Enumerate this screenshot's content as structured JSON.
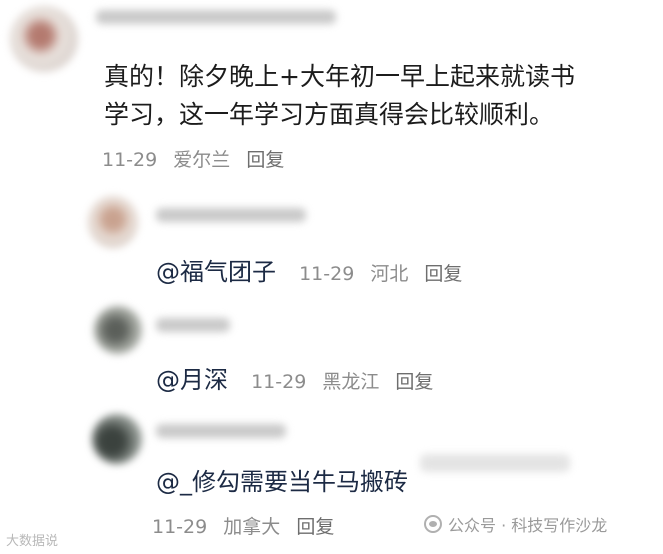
{
  "main_comment": {
    "line1": "真的！除夕晚上+大年初一早上起来就读书",
    "line2": "学习，这一年学习方面真得会比较顺利。",
    "date": "11-29",
    "location": "爱尔兰",
    "reply_label": "回复"
  },
  "replies": [
    {
      "mention": "@福气团子",
      "date": "11-29",
      "location": "河北",
      "reply_label": "回复"
    },
    {
      "mention": "@月深",
      "date": "11-29",
      "location": "黑龙江",
      "reply_label": "回复"
    },
    {
      "mention": "@_修勾需要当牛马搬砖",
      "date": "11-29",
      "location": "加拿大",
      "reply_label": "回复"
    }
  ],
  "watermarks": {
    "left": "大数据说",
    "right": "公众号 · 科技写作沙龙"
  }
}
